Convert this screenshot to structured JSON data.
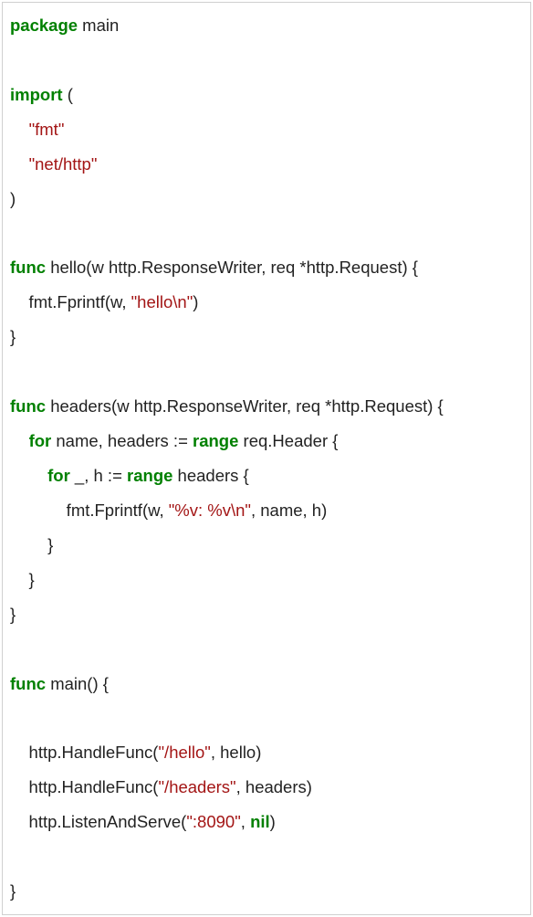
{
  "code": {
    "kw_package": "package",
    "pkg_name": " main",
    "kw_import": "import",
    "import_open": " (",
    "import1": "\"fmt\"",
    "import2": "\"net/http\"",
    "close_paren": ")",
    "kw_func1": "func",
    "hello_sig": " hello(w http.ResponseWriter, req *http.Request) {",
    "hello_body1a": "    fmt.Fprintf(w, ",
    "hello_body1b": "\"hello\\n\"",
    "hello_body1c": ")",
    "close_brace": "}",
    "kw_func2": "func",
    "headers_sig": " headers(w http.ResponseWriter, req *http.Request) {",
    "kw_for1": "for",
    "headers_l1a": " name, headers := ",
    "kw_range1": "range",
    "headers_l1b": " req.Header {",
    "kw_for2": "for",
    "headers_l2a": " _, h := ",
    "kw_range2": "range",
    "headers_l2b": " headers {",
    "headers_l3a": "            fmt.Fprintf(w, ",
    "headers_l3b": "\"%v: %v\\n\"",
    "headers_l3c": ", name, h)",
    "headers_close1": "        }",
    "headers_close2": "    }",
    "kw_func3": "func",
    "main_sig": " main() {",
    "main_l1a": "    http.HandleFunc(",
    "main_l1b": "\"/hello\"",
    "main_l1c": ", hello)",
    "main_l2a": "    http.HandleFunc(",
    "main_l2b": "\"/headers\"",
    "main_l2c": ", headers)",
    "main_l3a": "    http.ListenAndServe(",
    "main_l3b": "\":8090\"",
    "main_l3c": ", ",
    "kw_nil": "nil",
    "main_l3d": ")",
    "indent4": "    ",
    "indent8": "        "
  }
}
